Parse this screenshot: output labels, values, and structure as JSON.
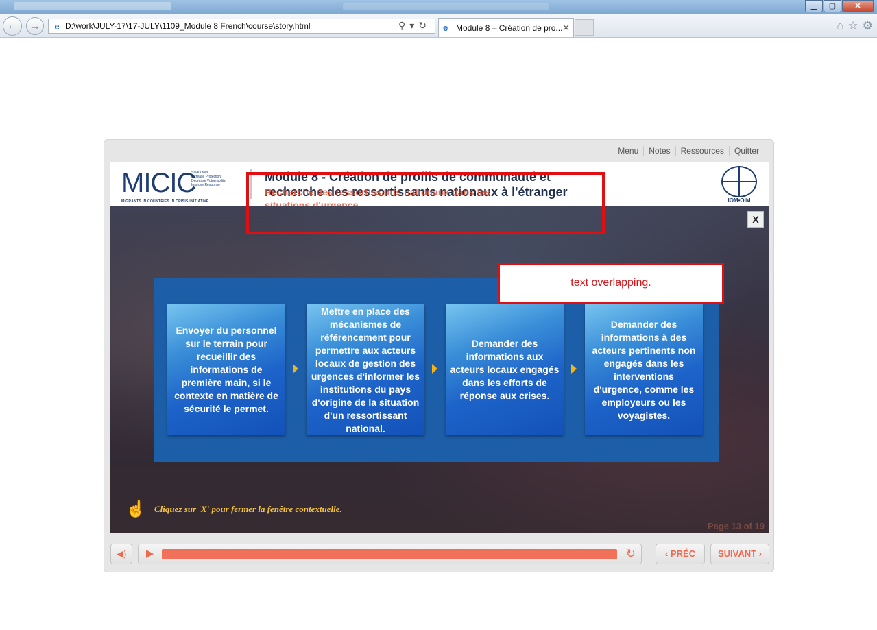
{
  "browser": {
    "url": "D:\\work\\JULY-17\\17-JULY\\1109_Module 8 French\\course\\story.html",
    "tab_title": "Module 8 – Création de pro...",
    "tab_close": "✕",
    "minimize": "▁",
    "maximize": "▢",
    "close": "✕"
  },
  "player": {
    "menu": [
      "Menu",
      "Notes",
      "Ressources",
      "Quitter"
    ],
    "header": {
      "logo_text": "MICIC",
      "logo_tagline": [
        "Save Lives",
        "Increase Protection",
        "Decrease Vulnerability",
        "Improve Response"
      ],
      "logo_bar": "MIGRANTS IN COUNTRIES IN CRISIS INITIATIVE",
      "title_line1": "Module 8 - Création de profils de communauté et",
      "title_line2": "recherche des ressortissants nationaux à l'étranger",
      "subtitle": "Recherche des ressortissants nationaux dans les situations d'urgence",
      "iom_label": "IOM•OIM"
    },
    "close_label": "X",
    "cards": [
      "Envoyer du personnel sur le terrain pour recueillir des informations de première main, si le contexte en matière de sécurité le permet.",
      "Mettre en place des mécanismes de référencement pour permettre aux acteurs locaux de gestion des urgences d'informer les institutions du pays d'origine de la situation d'un ressortissant national.",
      "Demander des informations aux acteurs locaux engagés dans les efforts de réponse aux crises.",
      "Demander des informations à des acteurs pertinents non engagés dans les interventions d'urgence, comme les employeurs ou les voyagistes."
    ],
    "hint": "Cliquez sur 'X' pour fermer la fenêtre contextuelle.",
    "page_indicator": "Page 13 of 19",
    "prev_label": "‹ PRÉC",
    "next_label": "SUIVANT ›",
    "progress": 1.0
  },
  "annotation": {
    "text": "text overlapping."
  },
  "colors": {
    "accent": "#ee6a4f",
    "annotation": "#e10f12",
    "panel": "#1d5ea8"
  }
}
